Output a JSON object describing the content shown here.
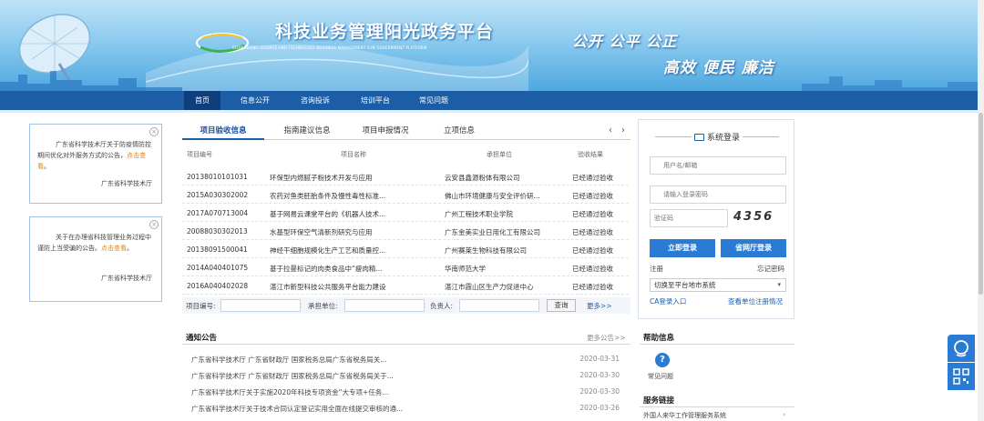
{
  "header": {
    "title": "科技业务管理阳光政务平台",
    "subtitle": "GUANGDONG SCIENCE AND TECHNOLOGY BUSINESS MANAGEMENT SUN GOVERNMENT PLATFORM",
    "slogan_line1": "公开 公平 公正",
    "slogan_line2": "高效 便民 廉洁"
  },
  "nav": {
    "items": [
      {
        "label": "首页",
        "active": true
      },
      {
        "label": "信息公开"
      },
      {
        "label": "咨询投诉"
      },
      {
        "label": "培训平台"
      },
      {
        "label": "常见问题"
      }
    ]
  },
  "notices_left": [
    {
      "text": "广东省科学技术厅关于防疫情防控期间优化对外服务方式的公告，",
      "link": "点击查看",
      "tail": "。",
      "sign": "广东省科学技术厅"
    },
    {
      "text": "关于在办理省科技管理业务过程中谨防上当受骗的公告。",
      "link": "点击查看",
      "tail": "。",
      "sign": "广东省科学技术厅"
    }
  ],
  "project_tabs": {
    "tabs": [
      {
        "label": "项目验收信息",
        "active": true
      },
      {
        "label": "指南建议信息"
      },
      {
        "label": "项目申报情况"
      },
      {
        "label": "立项信息"
      }
    ],
    "prev": "‹",
    "next": "›"
  },
  "project_table": {
    "headers": [
      "项目编号",
      "项目名称",
      "承担单位",
      "验收结果"
    ],
    "rows": [
      [
        "20138010101031",
        "环保型内燃腻子粉技术开发与应用",
        "云安县鑫源粉体有限公司",
        "已经通过验收"
      ],
      [
        "2015A030302002",
        "农药对鱼类胚胎条件及慢性毒性标准...",
        "佛山市环境健康与安全评价研...",
        "已经通过验收"
      ],
      [
        "2017A070713004",
        "基于网易云课堂平台的《机器人技术...",
        "广州工程技术职业学院",
        "已经通过验收"
      ],
      [
        "20088030302013",
        "水基型环保空气清新剂研究与应用",
        "广东金美实业日用化工有限公司",
        "已经通过验收"
      ],
      [
        "20138091500041",
        "神经干细胞规模化生产工艺和质量控...",
        "广州赛莱生物科技有限公司",
        "已经通过验收"
      ],
      [
        "2014A040401075",
        "基于拉曼标记的肉类食品中“瘦肉精...",
        "华南师范大学",
        "已经通过验收"
      ],
      [
        "2016A040402028",
        "湛江市新型科技公共服务平台能力建设",
        "湛江市霞山区生产力促进中心",
        "已经通过验收"
      ]
    ]
  },
  "filter": {
    "code_label": "项目编号:",
    "unit_label": "承担单位:",
    "person_label": "负责人:",
    "search_button": "查询",
    "more": "更多>>"
  },
  "announcements": {
    "title": "通知公告",
    "more": "更多公告>>",
    "items": [
      {
        "title": "广东省科学技术厅 广东省财政厅 国家税务总局广东省税务局关...",
        "date": "2020-03-31"
      },
      {
        "title": "广东省科学技术厅 广东省财政厅 国家税务总局广东省税务局关于...",
        "date": "2020-03-30"
      },
      {
        "title": "广东省科学技术厅关于实施2020年科技专项资金“大专项+任务...",
        "date": "2020-03-30"
      },
      {
        "title": "广东省科学技术厅关于技术合同认定登记实用全面在线提交审核的通...",
        "date": "2020-03-26"
      }
    ]
  },
  "login": {
    "title": "系统登录",
    "username_placeholder": "用户名/邮箱",
    "password_placeholder": "请输入登录密码",
    "captcha_placeholder": "验证码",
    "captcha_code": "4356",
    "login_button": "立即登录",
    "hall_button": "省网厅登录",
    "register": "注册",
    "forgot": "忘记密码",
    "switch_system": "切换至平台地市系统",
    "ca_login": "CA登录入口",
    "check_unit": "查看单位注册情况"
  },
  "help": {
    "title": "帮助信息",
    "faq": "常见问题"
  },
  "service": {
    "title": "服务链接",
    "first_link": "外国人来华工作管理服务系统"
  },
  "colors": {
    "nav_bg": "#1c5ea6",
    "accent": "#2a7bd3",
    "link_orange": "#e8820c"
  }
}
